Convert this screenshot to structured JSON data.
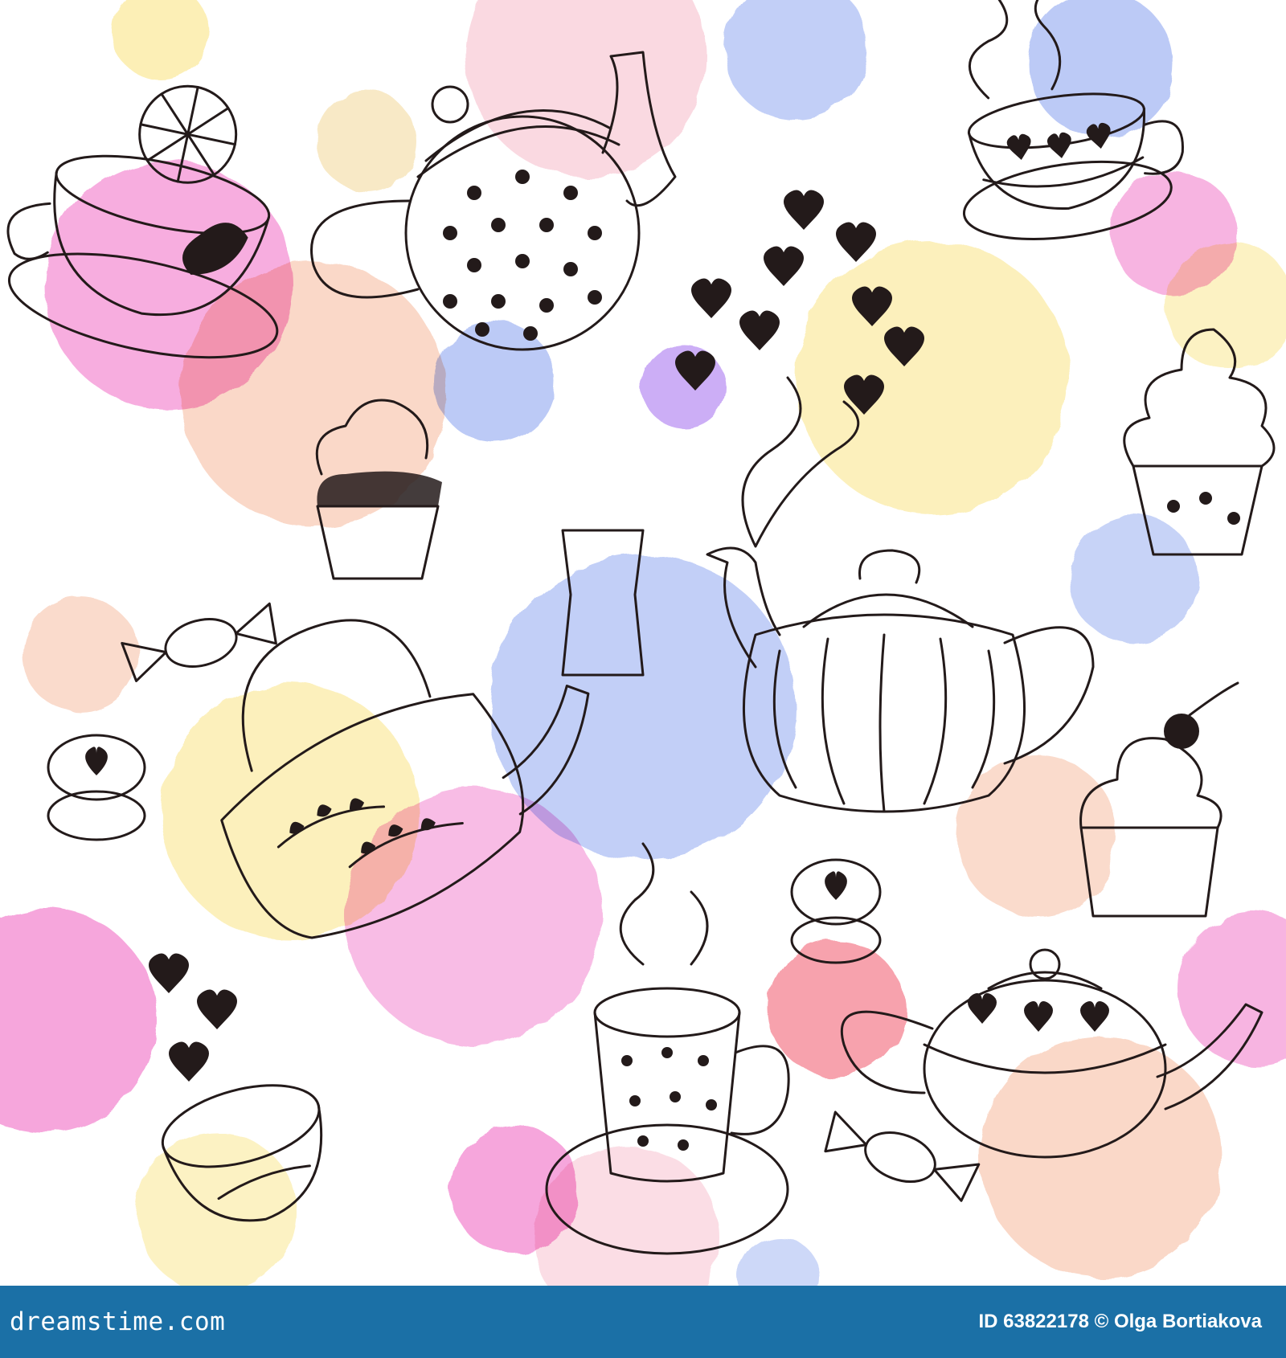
{
  "palette": {
    "pink": "#f06ac4",
    "peach": "#f6b89a",
    "yellow": "#f9e27a",
    "blue": "#8fa7f0",
    "purple": "#b78cf3",
    "coral": "#f3707f",
    "ink": "#231a1a",
    "footer_bg": "#1b70a6"
  },
  "footer": {
    "brand": "dreamstime.com",
    "credit": "ID 63822178 © Olga Bortiakova"
  },
  "items": [
    "teapot-polka-dot",
    "teapot-striped",
    "teapot-hearts",
    "kettle-leaves",
    "teacup-lemon-mint",
    "teacup-hearts",
    "teacup-polka-dot",
    "bowl-leaves",
    "cupcake-frosted",
    "cupcake-cherry",
    "cupcake-small",
    "wrapped-candy",
    "macaron-heart",
    "hearts-steam"
  ]
}
